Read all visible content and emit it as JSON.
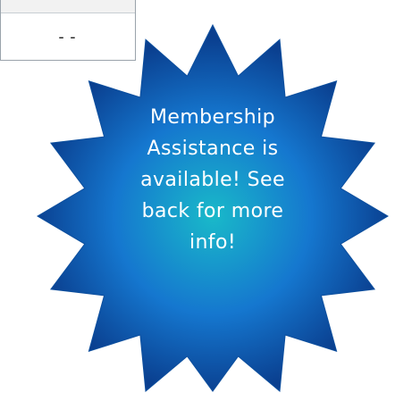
{
  "table": {
    "cell_value": "--"
  },
  "callout": {
    "text": "Membership\nAssistance is\navailable! See\nback for more\ninfo!",
    "colors": {
      "center": "#19b9c9",
      "mid": "#1577cf",
      "edge": "#0a3f8f",
      "text": "#ffffff"
    }
  }
}
